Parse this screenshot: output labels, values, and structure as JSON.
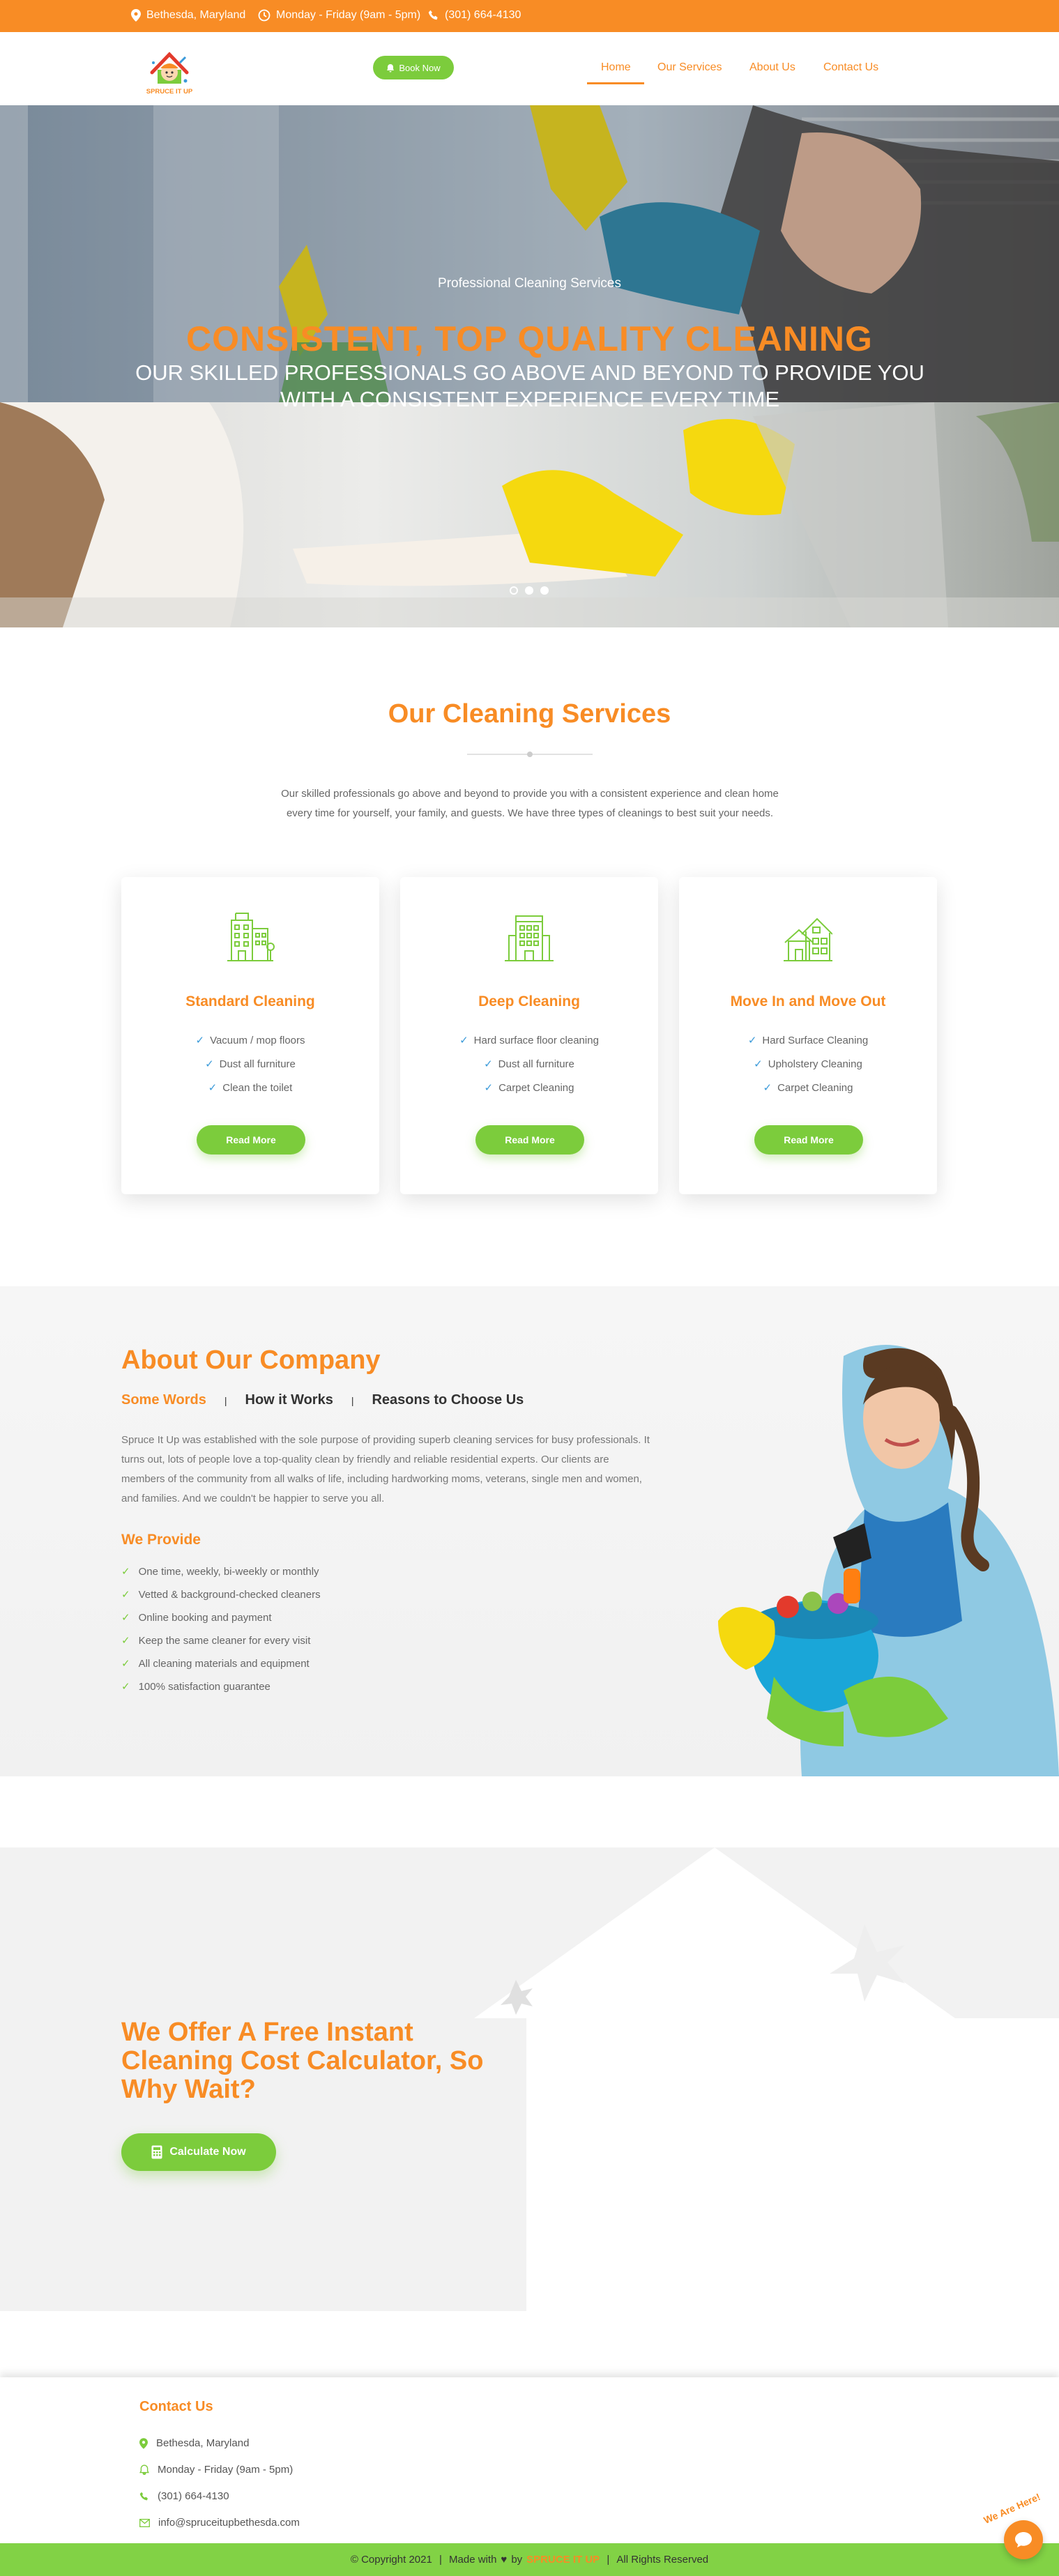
{
  "colors": {
    "accent": "#f88c25",
    "green": "#7ccc3c",
    "footer_green": "#82d245"
  },
  "topbar": {
    "location": "Bethesda, Maryland",
    "hours": "Monday - Friday (9am - 5pm)",
    "phone": "(301) 664-4130"
  },
  "header": {
    "logo_text": "SPRUCE IT UP",
    "book_button": "Book Now",
    "nav": [
      "Home",
      "Our Services",
      "About Us",
      "Contact Us"
    ],
    "active_nav": "Home"
  },
  "hero": {
    "subtitle": "Professional Cleaning Services",
    "title": "CONSISTENT, TOP QUALITY CLEANING",
    "description": "OUR SKILLED PROFESSIONALS GO ABOVE AND BEYOND TO PROVIDE YOU WITH A CONSISTENT EXPERIENCE EVERY TIME",
    "slides": 3,
    "active_slide": 1
  },
  "services": {
    "title": "Our Cleaning Services",
    "intro": "Our skilled professionals go above and beyond to provide you with a consistent experience and clean home every time for yourself, your family, and guests. We have three types of cleanings to best suit your needs.",
    "cards": [
      {
        "icon": "apartment-building-icon",
        "title": "Standard Cleaning",
        "items": [
          "Vacuum / mop floors",
          "Dust all furniture",
          "Clean the toilet"
        ],
        "button": "Read More"
      },
      {
        "icon": "office-building-icon",
        "title": "Deep Cleaning",
        "items": [
          "Hard surface floor cleaning",
          "Dust all furniture",
          "Carpet Cleaning"
        ],
        "button": "Read More"
      },
      {
        "icon": "houses-icon",
        "title": "Move In and Move Out",
        "items": [
          "Hard Surface Cleaning",
          "Upholstery Cleaning",
          "Carpet Cleaning"
        ],
        "button": "Read More"
      }
    ]
  },
  "about": {
    "title": "About Our Company",
    "tabs": [
      "Some Words",
      "How it Works",
      "Reasons to Choose Us"
    ],
    "active_tab": "Some Words",
    "text": "Spruce It Up was established with the sole purpose of providing superb cleaning services for busy professionals. It turns out, lots of people love a top-quality clean by friendly and reliable residential experts. Our clients are members of the community from all walks of life, including hardworking moms, veterans, single men and women, and families. And we couldn't be happier to serve you all.",
    "provide_title": "We Provide",
    "provide_items": [
      "One time, weekly, bi-weekly or monthly",
      "Vetted & background-checked cleaners",
      "Online booking and payment",
      "Keep the same cleaner for every visit",
      "All cleaning materials and equipment",
      "100% satisfaction guarantee"
    ]
  },
  "calculator": {
    "title": "We Offer A Free Instant Cleaning Cost Calculator, So Why Wait?",
    "button": "Calculate Now"
  },
  "footer": {
    "title": "Contact Us",
    "location": "Bethesda, Maryland",
    "hours": "Monday - Friday (9am - 5pm)",
    "phone": "(301) 664-4130",
    "email": "info@spruceitupbethesda.com"
  },
  "copyright": {
    "prefix": "© Copyright 2021",
    "made_with": "Made with",
    "by": "by",
    "brand": "SPRUCE IT UP",
    "rights": "All Rights Reserved"
  },
  "chat": {
    "label": "We Are Here!"
  }
}
